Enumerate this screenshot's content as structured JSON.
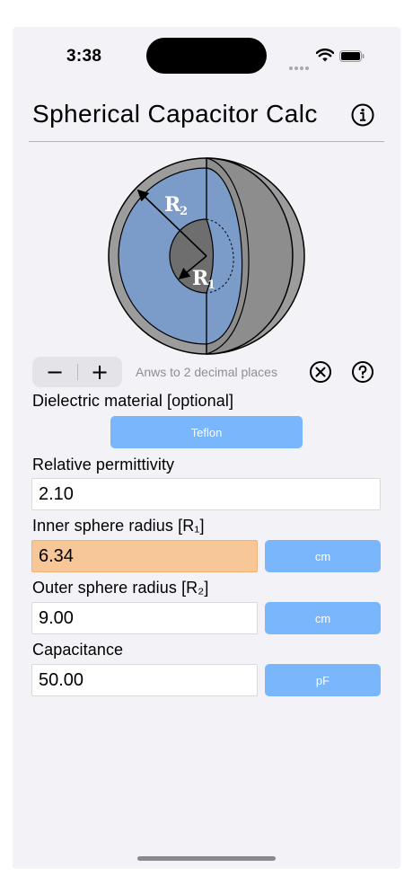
{
  "status_bar": {
    "time": "3:38"
  },
  "header": {
    "title": "Spherical Capacitor Calc"
  },
  "diagram": {
    "outer_label": "R",
    "outer_sub": "2",
    "inner_label": "R",
    "inner_sub": "1"
  },
  "controls": {
    "decrement_label": "−",
    "increment_label": "+",
    "precision_text": "Anws to 2 decimal places"
  },
  "dielectric": {
    "label": "Dielectric material [optional]",
    "material_button": "Teflon"
  },
  "permittivity": {
    "label": "Relative permittivity",
    "value": "2.10"
  },
  "inner_radius": {
    "label": "Inner sphere radius [R₁]",
    "value": "6.34",
    "unit": "cm"
  },
  "outer_radius": {
    "label": "Outer sphere radius [R₂]",
    "value": "9.00",
    "unit": "cm"
  },
  "capacitance": {
    "label": "Capacitance",
    "value": "50.00",
    "unit": "pF"
  },
  "colors": {
    "accent_button": "#7ab6fb",
    "active_field": "#f8c797",
    "dielectric_fill": "#7b9cc9",
    "shell": "#9a9a9a"
  }
}
